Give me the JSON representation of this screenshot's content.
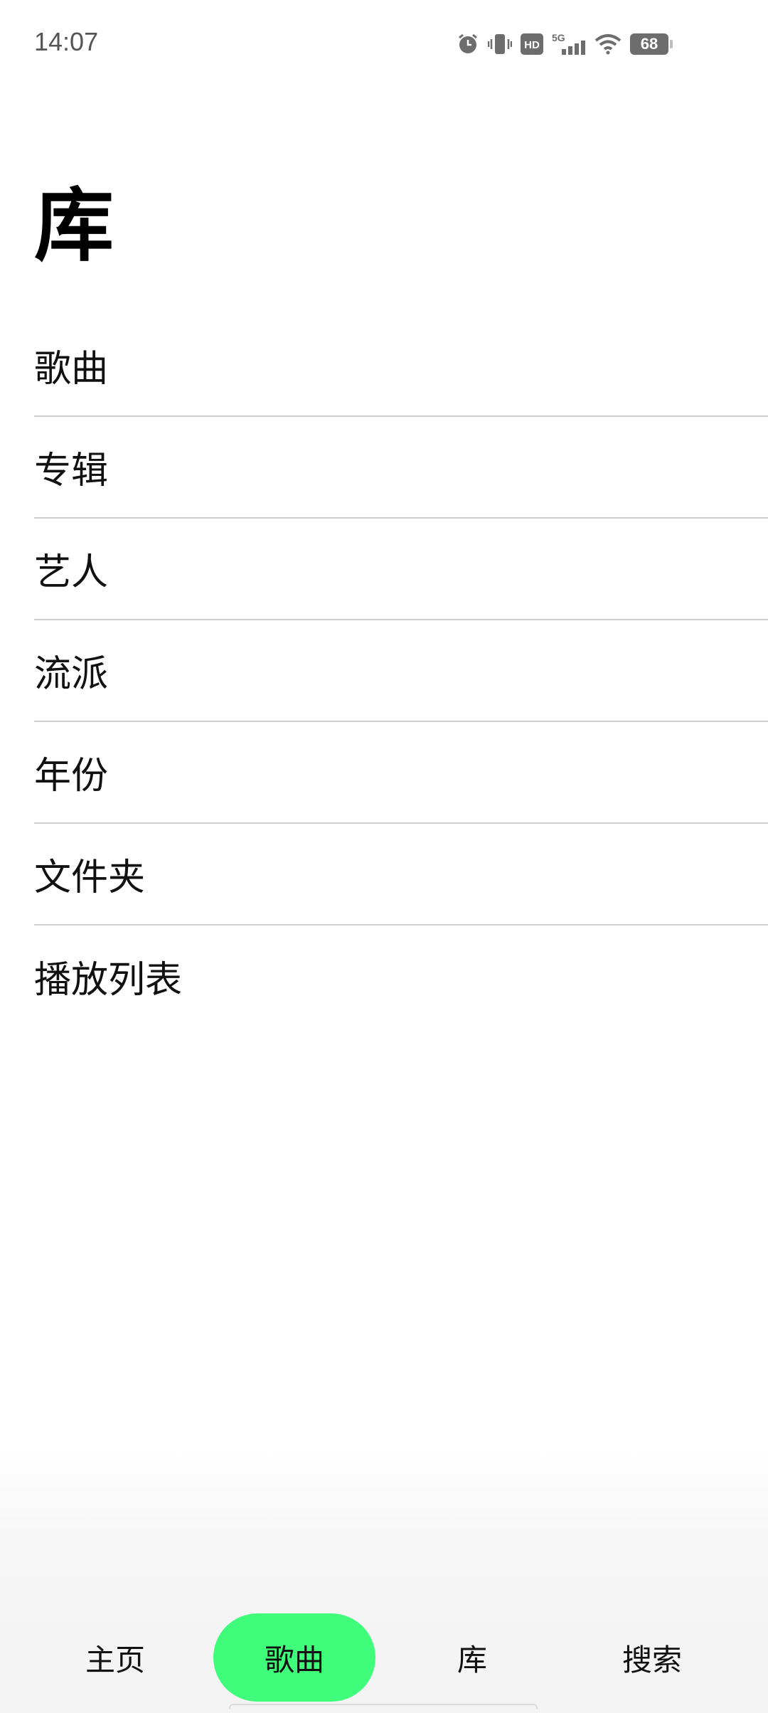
{
  "status_bar": {
    "time": "14:07",
    "network": "5G",
    "hd_label": "HD",
    "battery": "68",
    "icons": [
      "alarm-icon",
      "vibrate-icon",
      "hd-icon",
      "signal-5g-icon",
      "wifi-icon",
      "battery-icon"
    ]
  },
  "page": {
    "title": "库"
  },
  "library": {
    "items": [
      {
        "label": "歌曲"
      },
      {
        "label": "专辑"
      },
      {
        "label": "艺人"
      },
      {
        "label": "流派"
      },
      {
        "label": "年份"
      },
      {
        "label": "文件夹"
      },
      {
        "label": "播放列表"
      }
    ]
  },
  "bottom_nav": {
    "tabs": [
      {
        "label": "主页",
        "active": false
      },
      {
        "label": "歌曲",
        "active": true
      },
      {
        "label": "库",
        "active": false
      },
      {
        "label": "搜索",
        "active": false
      }
    ],
    "active_color": "#3ffd7b"
  }
}
